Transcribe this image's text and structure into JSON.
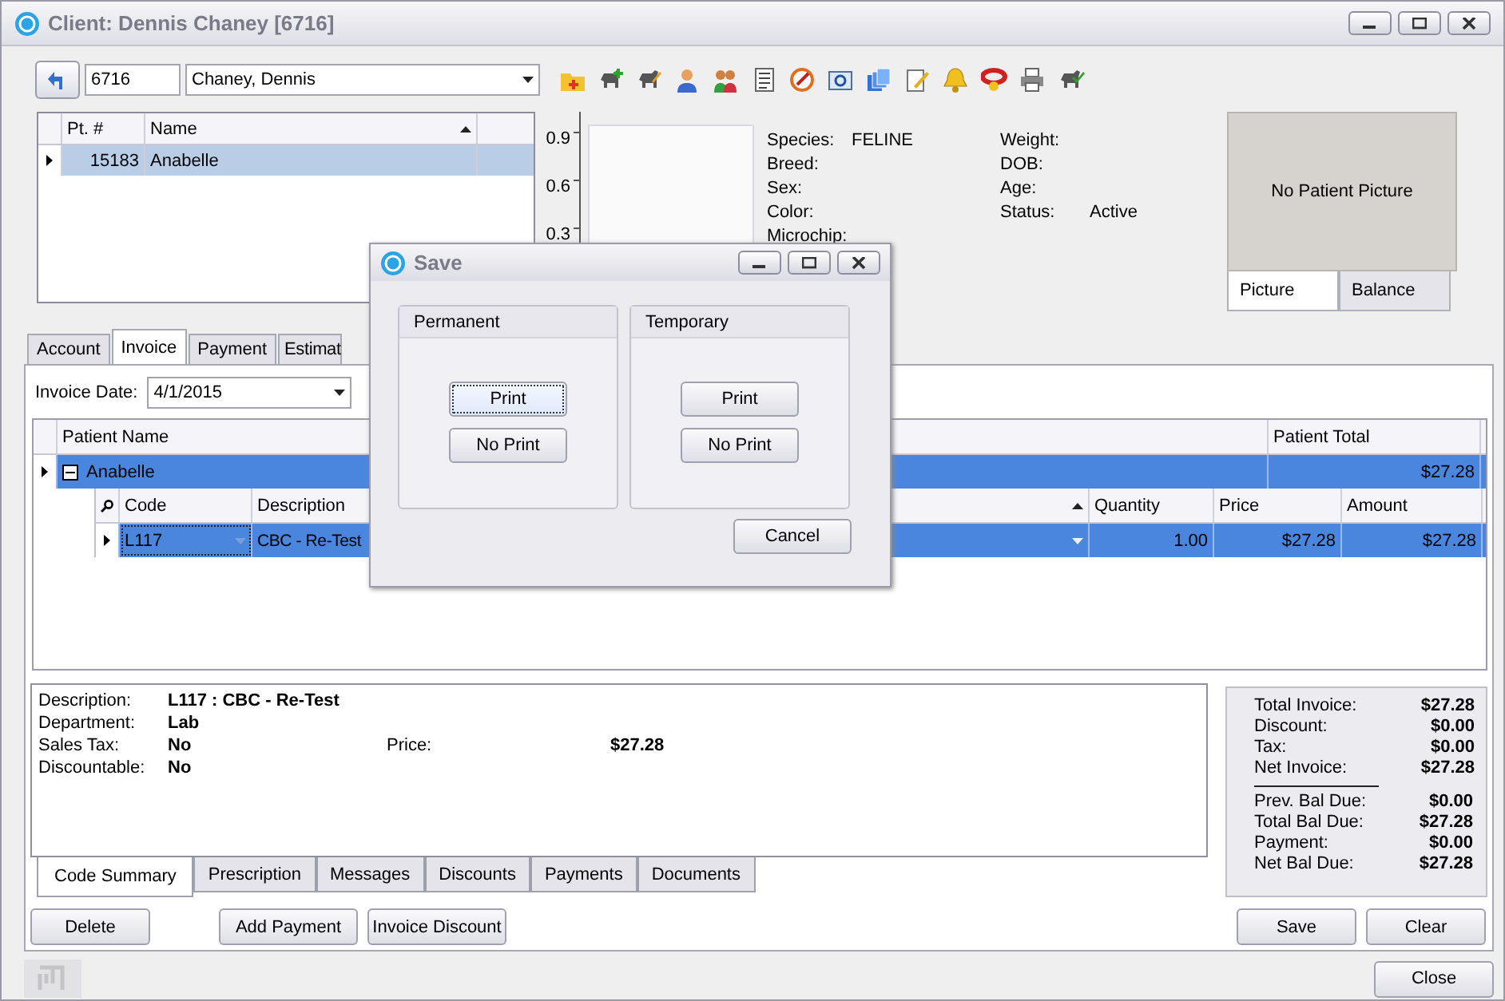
{
  "window": {
    "title": "Client: Dennis Chaney [6716]"
  },
  "client": {
    "number": "6716",
    "name": "Chaney, Dennis"
  },
  "patients": {
    "columns": [
      "Pt. #",
      "Name"
    ],
    "rows": [
      {
        "number": "15183",
        "name": "Anabelle",
        "selected": true
      }
    ]
  },
  "weight_chart": {
    "y_labels": [
      "0.9",
      "0.6",
      "0.3"
    ]
  },
  "patient_info": {
    "left": [
      {
        "label": "Species:",
        "value": "FELINE"
      },
      {
        "label": "Breed:"
      },
      {
        "label": "Sex:"
      },
      {
        "label": "Color:"
      },
      {
        "label": "Microchip:"
      }
    ],
    "right": [
      {
        "label": "Weight:"
      },
      {
        "label": "DOB:"
      },
      {
        "label": "Age:"
      },
      {
        "label": "Status:",
        "value": "Active"
      }
    ]
  },
  "picture_panel": {
    "text": "No Patient Picture",
    "tabs": [
      {
        "label": "Picture",
        "selected": true
      },
      {
        "label": "Balance",
        "selected": false
      }
    ]
  },
  "tabs": [
    {
      "label": "Account",
      "selected": false
    },
    {
      "label": "Invoice",
      "selected": true
    },
    {
      "label": "Payment",
      "selected": false
    },
    {
      "label": "Estimat",
      "selected": false
    }
  ],
  "invoice_date": {
    "label": "Invoice Date:",
    "value": "4/1/2015"
  },
  "invoice_grid": {
    "columns": [
      "Patient Name",
      "Patient Total"
    ],
    "rows": [
      {
        "patient": "Anabelle",
        "total": "$27.28",
        "selected": true,
        "expanded": true,
        "items": {
          "columns": [
            "Code",
            "Description",
            "Quantity",
            "Price",
            "Amount"
          ],
          "rows": [
            {
              "code": "L117",
              "description": "CBC - Re-Test",
              "quantity": "1.00",
              "price": "$27.28",
              "amount": "$27.28",
              "selected": true
            }
          ]
        }
      }
    ]
  },
  "code_summary": {
    "fields": [
      {
        "label": "Description:",
        "value": "L117 : CBC - Re-Test"
      },
      {
        "label": "Department:",
        "value": "Lab"
      },
      {
        "label": "Sales Tax:",
        "value": "No"
      },
      {
        "label": "Discountable:",
        "value": "No"
      }
    ],
    "price": {
      "label": "Price:",
      "value": "$27.28"
    }
  },
  "summary_tabs": [
    {
      "label": "Code Summary",
      "selected": true
    },
    {
      "label": "Prescription",
      "selected": false
    },
    {
      "label": "Messages",
      "selected": false
    },
    {
      "label": "Discounts",
      "selected": false
    },
    {
      "label": "Payments",
      "selected": false
    },
    {
      "label": "Documents",
      "selected": false
    }
  ],
  "totals": [
    [
      {
        "label": "Total Invoice:",
        "value": "$27.28"
      },
      {
        "label": "Discount:",
        "value": "$0.00"
      },
      {
        "label": "Tax:",
        "value": "$0.00"
      },
      {
        "label": "Net Invoice:",
        "value": "$27.28"
      }
    ],
    [
      {
        "label": "Prev. Bal Due:",
        "value": "$0.00"
      },
      {
        "label": "Total Bal Due:",
        "value": "$27.28"
      },
      {
        "label": "Payment:",
        "value": "$0.00"
      },
      {
        "label": "Net Bal Due:",
        "value": "$27.28"
      }
    ]
  ],
  "actions_left": [
    "Delete",
    "Add Payment",
    "Invoice Discount"
  ],
  "actions_right": [
    "Save",
    "Clear"
  ],
  "close_button": "Close",
  "dialog": {
    "title": "Save",
    "groups": [
      {
        "title": "Permanent",
        "buttons": [
          {
            "label": "Print",
            "focused": true
          },
          {
            "label": "No Print",
            "focused": false
          }
        ]
      },
      {
        "title": "Temporary",
        "buttons": [
          {
            "label": "Print",
            "focused": false
          },
          {
            "label": "No Print",
            "focused": false
          }
        ]
      }
    ],
    "cancel": "Cancel"
  }
}
